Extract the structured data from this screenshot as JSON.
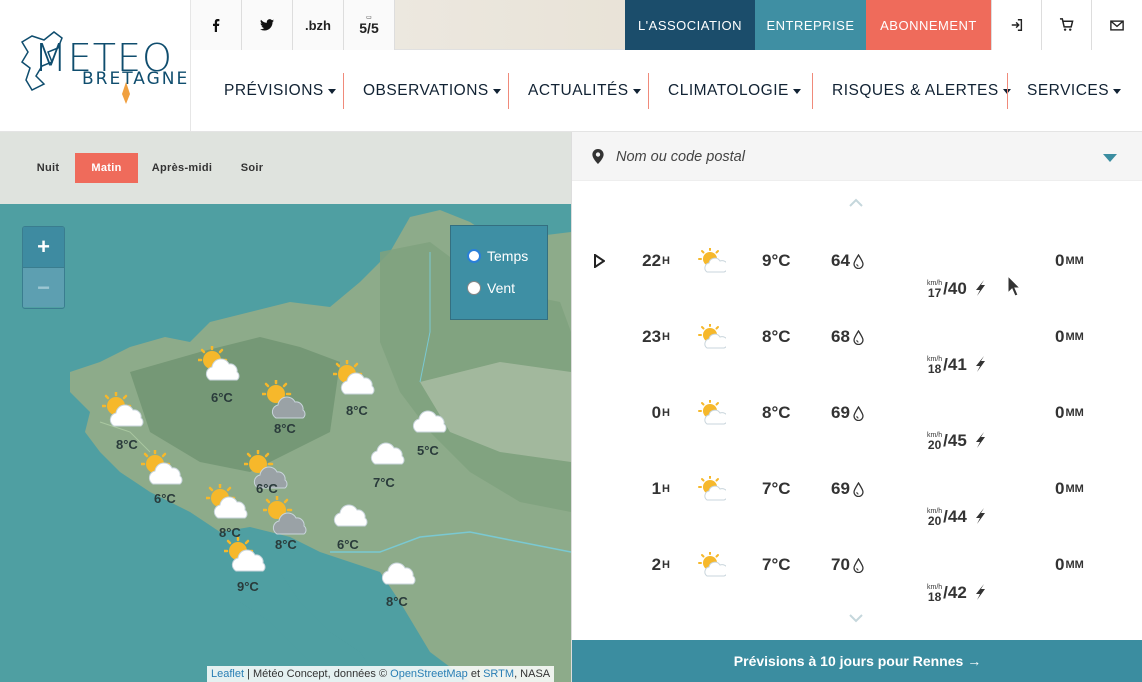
{
  "logo": {
    "line1": "METEO",
    "line2": "BRETAGNE"
  },
  "social": [
    {
      "name": "facebook",
      "label": "f"
    },
    {
      "name": "twitter",
      "label": ""
    },
    {
      "name": "bzh",
      "label": ".bzh"
    },
    {
      "name": "livre-5-5",
      "label": "5/5"
    }
  ],
  "topbar": {
    "association": "L'Association",
    "entreprise": "Entreprise",
    "abonnement": "Abonnement",
    "colors": {
      "association": "#1b4d6b",
      "entreprise": "#3f8fa3",
      "abonnement": "#ef6b5b"
    }
  },
  "nav": [
    "Prévisions",
    "Observations",
    "Actualités",
    "Climatologie",
    "Risques & Alertes",
    "Services"
  ],
  "periods": [
    "Nuit",
    "Matin",
    "Après-midi",
    "Soir"
  ],
  "active_period": "Matin",
  "zoom": {
    "in": "+",
    "out": "−"
  },
  "layers": {
    "temps": "Temps",
    "vent": "Vent",
    "selected": "Temps"
  },
  "map_points": [
    {
      "label": "6°C",
      "icon": "sun-cloud"
    },
    {
      "label": "8°C",
      "icon": "sun-cloud"
    },
    {
      "label": "8°C",
      "icon": "sun-dark-cloud"
    },
    {
      "label": "8°C",
      "icon": "sun-cloud"
    },
    {
      "label": "6°C",
      "icon": "sun-cloud"
    },
    {
      "label": "6°C",
      "icon": "sun-dark-cloud"
    },
    {
      "label": "7°C",
      "icon": "cloud"
    },
    {
      "label": "5°C",
      "icon": "cloud"
    },
    {
      "label": "8°C",
      "icon": "sun-cloud"
    },
    {
      "label": "8°C",
      "icon": "sun-dark-cloud"
    },
    {
      "label": "6°C",
      "icon": "cloud"
    },
    {
      "label": "9°C",
      "icon": "sun-cloud"
    },
    {
      "label": "8°C",
      "icon": "cloud"
    }
  ],
  "attribution": {
    "leaflet": "Leaflet",
    "sep1": " | Météo Concept, données © ",
    "osm": "OpenStreetMap",
    "et": " et ",
    "srtm": "SRTM",
    "nasa": ", NASA"
  },
  "search": {
    "placeholder": "Nom ou code postal"
  },
  "forecast": [
    {
      "hour": "22",
      "temp": "9°C",
      "humidity": "64",
      "wind_avg": "17",
      "wind_gust": "/40",
      "rain": "0"
    },
    {
      "hour": "23",
      "temp": "8°C",
      "humidity": "68",
      "wind_avg": "18",
      "wind_gust": "/41",
      "rain": "0"
    },
    {
      "hour": "0",
      "temp": "8°C",
      "humidity": "69",
      "wind_avg": "20",
      "wind_gust": "/45",
      "rain": "0"
    },
    {
      "hour": "1",
      "temp": "7°C",
      "humidity": "69",
      "wind_avg": "20",
      "wind_gust": "/44",
      "rain": "0"
    },
    {
      "hour": "2",
      "temp": "7°C",
      "humidity": "70",
      "wind_avg": "18",
      "wind_gust": "/42",
      "rain": "0"
    }
  ],
  "units": {
    "hour": "H",
    "wind": "km/h",
    "rain": "MM"
  },
  "ten_day_button": "Prévisions à 10 jours pour Rennes →"
}
